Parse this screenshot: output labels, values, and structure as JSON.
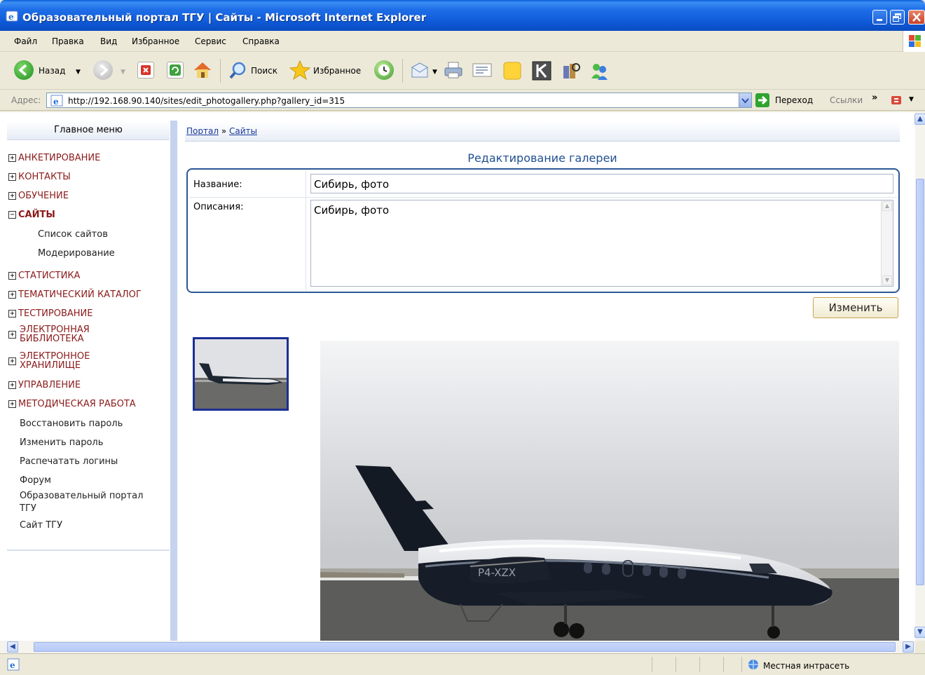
{
  "window": {
    "title": "Образовательный портал ТГУ | Сайты - Microsoft Internet Explorer"
  },
  "menu": {
    "items": [
      "Файл",
      "Правка",
      "Вид",
      "Избранное",
      "Сервис",
      "Справка"
    ]
  },
  "toolbar": {
    "back_label": "Назад",
    "search_label": "Поиск",
    "favorites_label": "Избранное"
  },
  "address": {
    "label": "Адрес:",
    "url": "http://192.168.90.140/sites/edit_photogallery.php?gallery_id=315",
    "go_label": "Переход",
    "links_label": "Ссылки"
  },
  "sidebar": {
    "header": "Главное меню",
    "sections": [
      {
        "label": "АНКЕТИРОВАНИЕ",
        "state": "+"
      },
      {
        "label": "КОНТАКТЫ",
        "state": "+"
      },
      {
        "label": "ОБУЧЕНИЕ",
        "state": "+"
      },
      {
        "label": "САЙТЫ",
        "state": "−"
      },
      {
        "label": "СТАТИСТИКА",
        "state": "+"
      },
      {
        "label": "ТЕМАТИЧЕСКИЙ КАТАЛОГ",
        "state": "+"
      },
      {
        "label": "ТЕСТИРОВАНИЕ",
        "state": "+"
      },
      {
        "label": "УПРАВЛЕНИЕ",
        "state": "+"
      },
      {
        "label": "МЕТОДИЧЕСКАЯ РАБОТА",
        "state": "+"
      }
    ],
    "multi": [
      {
        "line1": "ЭЛЕКТРОННАЯ",
        "line2": "БИБЛИОТЕКА",
        "state": "+"
      },
      {
        "line1": "ЭЛЕКТРОННОЕ",
        "line2": "ХРАНИЛИЩЕ",
        "state": "+"
      }
    ],
    "subitems": [
      "Список сайтов",
      "Модерирование"
    ],
    "links": [
      "Восстановить пароль",
      "Изменить пароль",
      "Распечатать логины",
      "Форум",
      "Образовательный портал",
      "ТГУ",
      "Сайт ТГУ"
    ]
  },
  "breadcrumb": {
    "items": [
      "Портал",
      "Сайты"
    ],
    "separator": "»"
  },
  "form": {
    "title": "Редактирование галереи",
    "name_label": "Название:",
    "name_value": "Сибирь, фото",
    "desc_label": "Описания:",
    "desc_value": "Сибирь, фото",
    "submit_label": "Изменить"
  },
  "photo": {
    "registration": "P4-XZX"
  },
  "status": {
    "zone": "Местная интрасеть"
  },
  "colors": {
    "title_blue": "#0a4cc0",
    "menu_red": "#8b1a1a",
    "heading_blue": "#1f4f92",
    "form_border": "#2b5796"
  }
}
